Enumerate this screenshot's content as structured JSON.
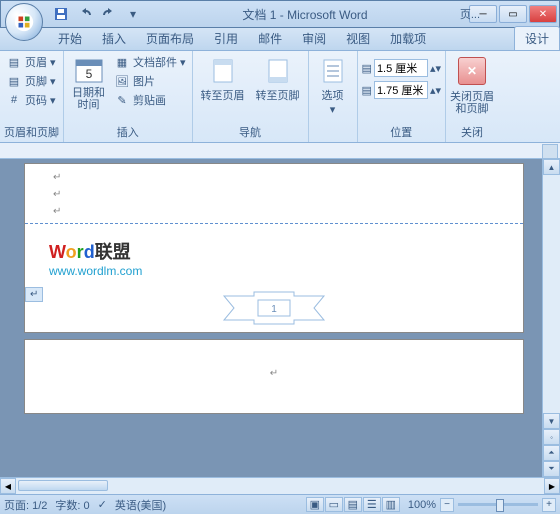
{
  "title": "文档 1 - Microsoft Word",
  "context_tab_label": "页...",
  "tabs": [
    "开始",
    "插入",
    "页面布局",
    "引用",
    "邮件",
    "审阅",
    "视图",
    "加载项"
  ],
  "active_tab": "设计",
  "ribbon": {
    "g1": {
      "label": "页眉和页脚",
      "header": "页眉",
      "footer": "页脚",
      "pagenum": "页码"
    },
    "g2": {
      "label": "插入",
      "datetime": "日期和\n时间",
      "parts": "文档部件",
      "picture": "图片",
      "clipart": "剪贴画"
    },
    "g3": {
      "label": "导航",
      "goto_header": "转至页眉",
      "goto_footer": "转至页脚"
    },
    "g4": {
      "label": "",
      "options": "选项"
    },
    "g5": {
      "label": "位置",
      "top": "1.5 厘米",
      "bottom": "1.75 厘米"
    },
    "g6": {
      "label": "关闭",
      "close": "关闭页眉\n和页脚"
    }
  },
  "watermark": {
    "brand": "Word联盟",
    "url": "www.wordlm.com"
  },
  "footer_pagenum": "1",
  "status": {
    "page": "页面: 1/2",
    "words": "字数: 0",
    "lang": "英语(美国)",
    "zoom": "100%"
  }
}
